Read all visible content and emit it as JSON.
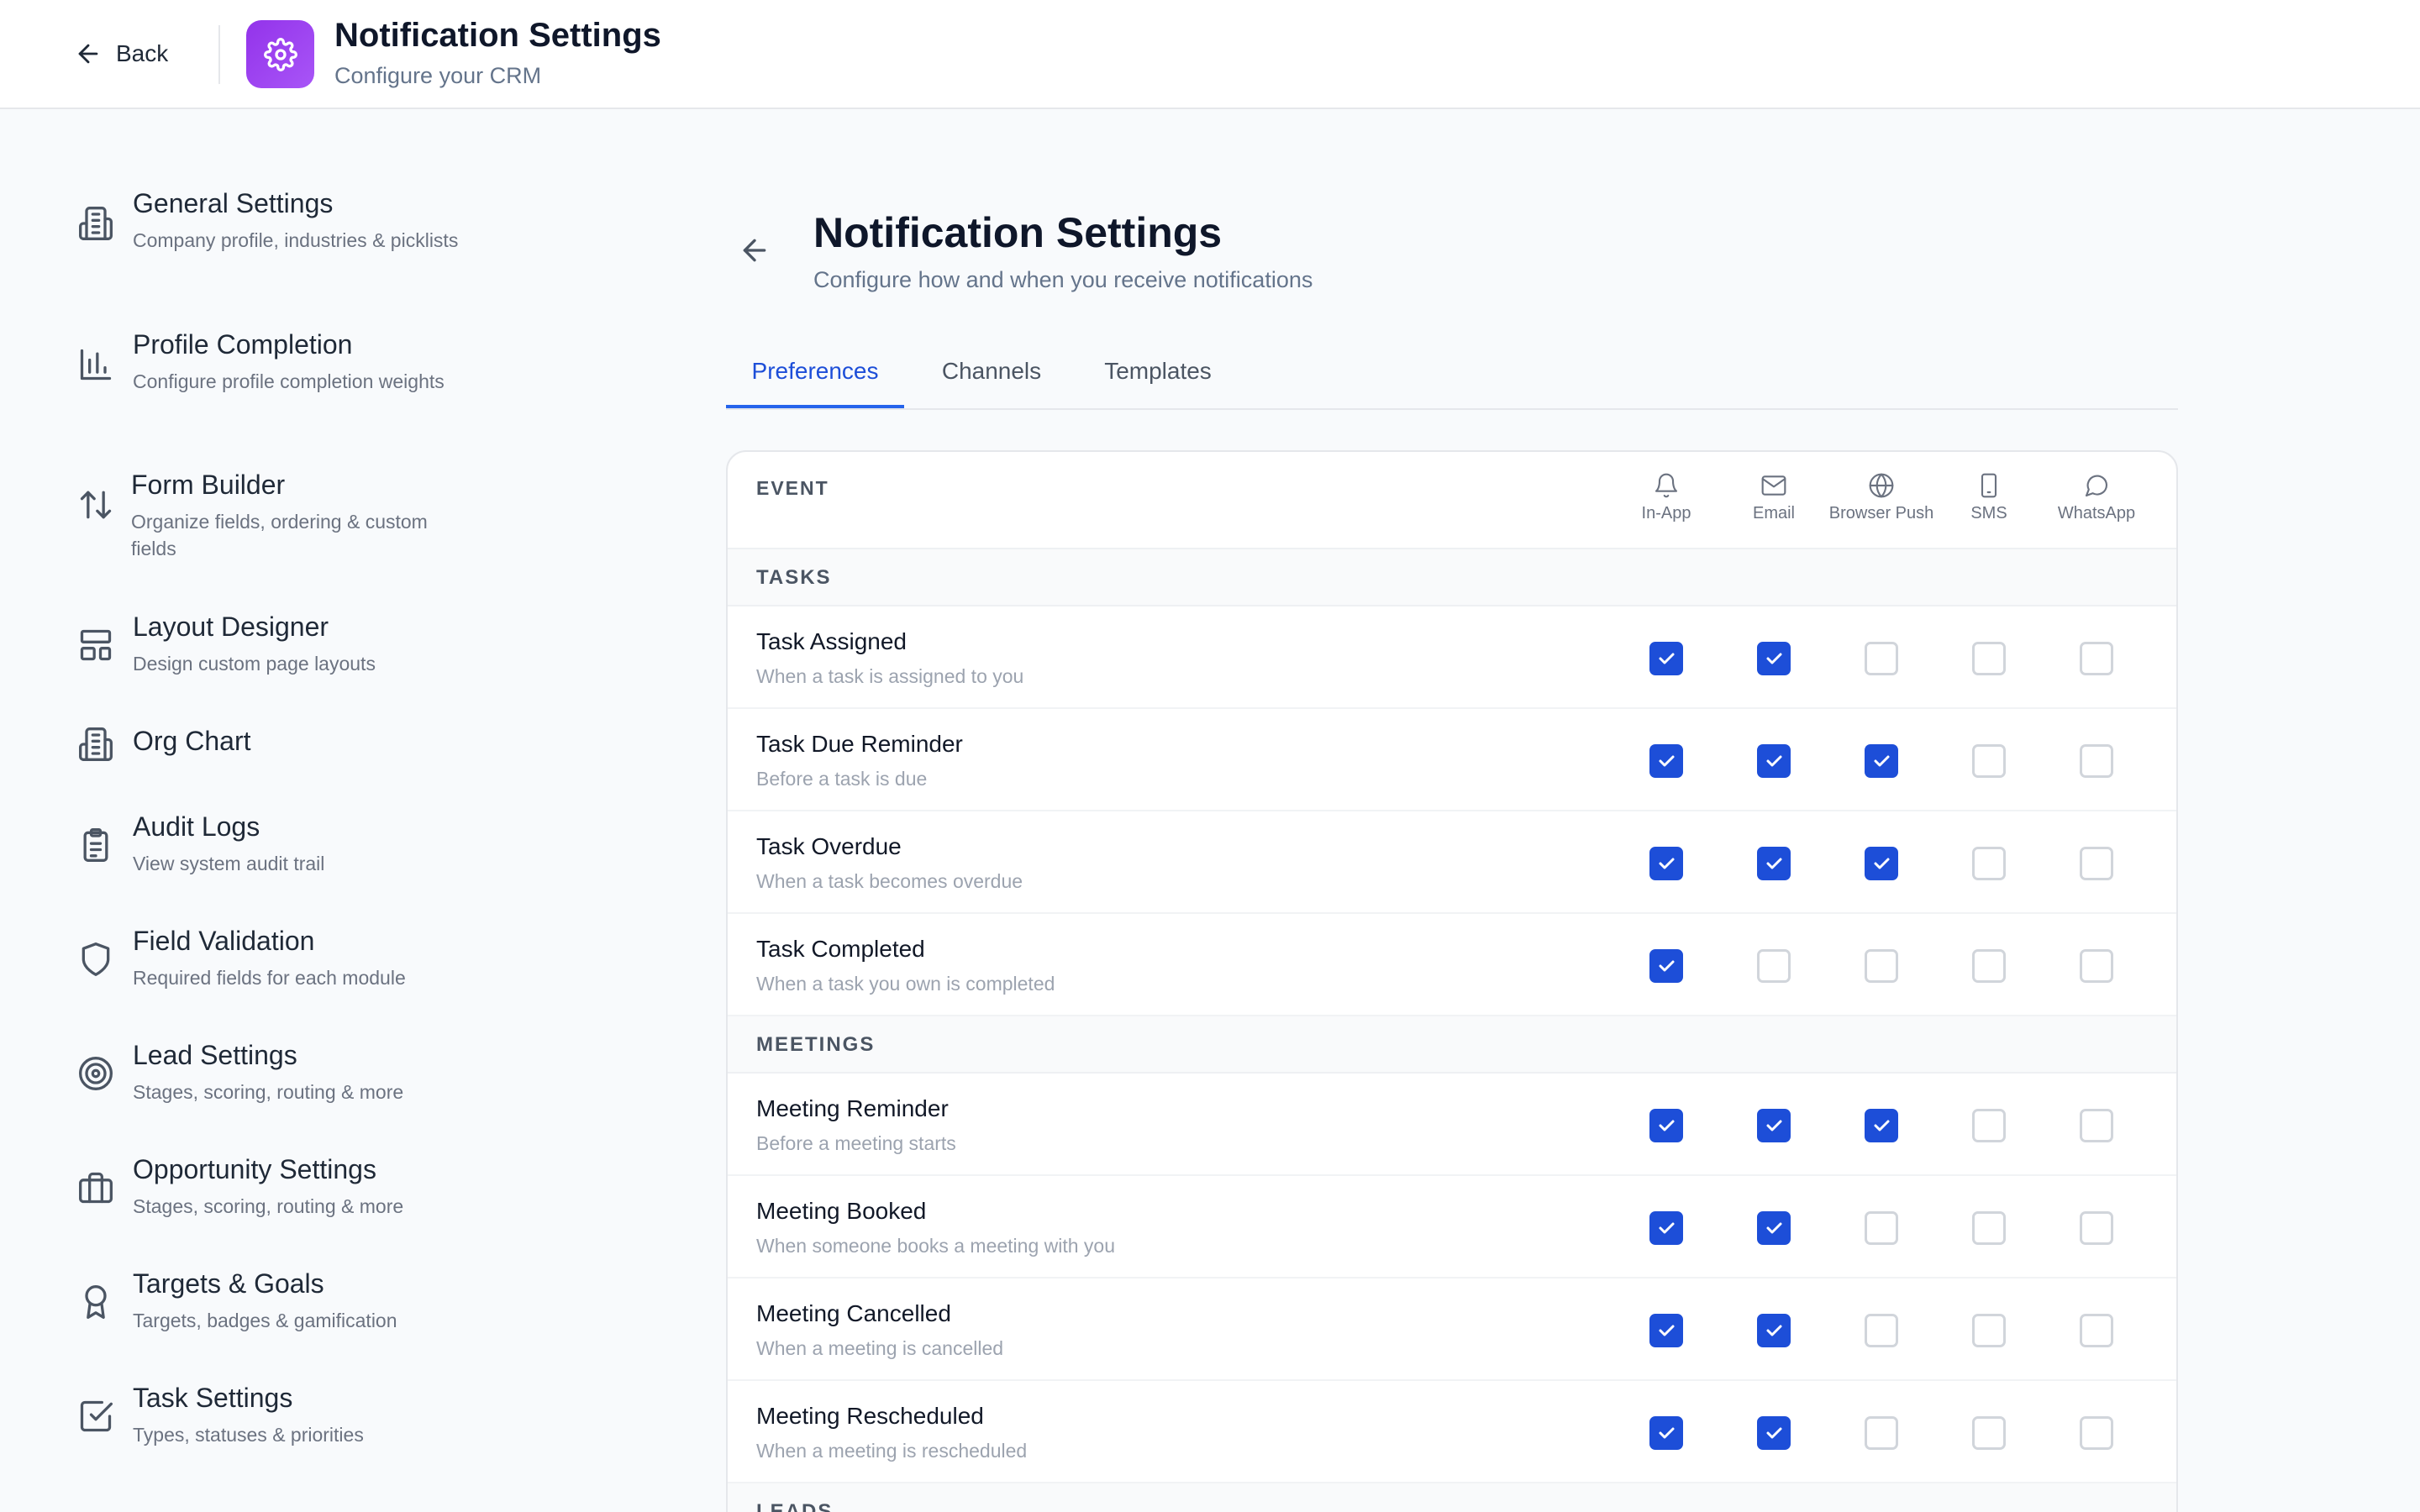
{
  "header": {
    "back_label": "Back",
    "title": "Notification Settings",
    "subtitle": "Configure your CRM"
  },
  "sidebar": {
    "items": [
      {
        "title": "General Settings",
        "desc": "Company profile, industries & picklists",
        "icon": "building-icon"
      },
      {
        "title": "Profile Completion",
        "desc": "Configure profile completion weights",
        "icon": "bar-chart-icon"
      },
      {
        "title": "Form Builder",
        "desc": "Organize fields, ordering & custom fields",
        "icon": "sort-arrows-icon"
      },
      {
        "title": "Layout Designer",
        "desc": "Design custom page layouts",
        "icon": "layout-icon"
      },
      {
        "title": "Org Chart",
        "desc": "",
        "icon": "building-icon"
      },
      {
        "title": "Audit Logs",
        "desc": "View system audit trail",
        "icon": "clipboard-icon"
      },
      {
        "title": "Field Validation",
        "desc": "Required fields for each module",
        "icon": "shield-icon"
      },
      {
        "title": "Lead Settings",
        "desc": "Stages, scoring, routing & more",
        "icon": "target-icon"
      },
      {
        "title": "Opportunity Settings",
        "desc": "Stages, scoring, routing & more",
        "icon": "briefcase-icon"
      },
      {
        "title": "Targets & Goals",
        "desc": "Targets, badges & gamification",
        "icon": "award-icon"
      },
      {
        "title": "Task Settings",
        "desc": "Types, statuses & priorities",
        "icon": "checkbox-icon"
      }
    ]
  },
  "main": {
    "title": "Notification Settings",
    "subtitle": "Configure how and when you receive notifications",
    "tabs": [
      {
        "label": "Preferences",
        "active": true
      },
      {
        "label": "Channels",
        "active": false
      },
      {
        "label": "Templates",
        "active": false
      }
    ]
  },
  "table": {
    "event_header": "EVENT",
    "channels": [
      {
        "label": "In-App",
        "icon": "bell-icon"
      },
      {
        "label": "Email",
        "icon": "mail-icon"
      },
      {
        "label": "Browser Push",
        "icon": "globe-icon"
      },
      {
        "label": "SMS",
        "icon": "phone-icon"
      },
      {
        "label": "WhatsApp",
        "icon": "chat-bubble-icon"
      }
    ],
    "sections": [
      {
        "name": "TASKS",
        "rows": [
          {
            "title": "Task Assigned",
            "desc": "When a task is assigned to you",
            "checks": [
              true,
              true,
              false,
              false,
              false
            ]
          },
          {
            "title": "Task Due Reminder",
            "desc": "Before a task is due",
            "checks": [
              true,
              true,
              true,
              false,
              false
            ]
          },
          {
            "title": "Task Overdue",
            "desc": "When a task becomes overdue",
            "checks": [
              true,
              true,
              true,
              false,
              false
            ]
          },
          {
            "title": "Task Completed",
            "desc": "When a task you own is completed",
            "checks": [
              true,
              false,
              false,
              false,
              false
            ]
          }
        ]
      },
      {
        "name": "MEETINGS",
        "rows": [
          {
            "title": "Meeting Reminder",
            "desc": "Before a meeting starts",
            "checks": [
              true,
              true,
              true,
              false,
              false
            ]
          },
          {
            "title": "Meeting Booked",
            "desc": "When someone books a meeting with you",
            "checks": [
              true,
              true,
              false,
              false,
              false
            ]
          },
          {
            "title": "Meeting Cancelled",
            "desc": "When a meeting is cancelled",
            "checks": [
              true,
              true,
              false,
              false,
              false
            ]
          },
          {
            "title": "Meeting Rescheduled",
            "desc": "When a meeting is rescheduled",
            "checks": [
              true,
              true,
              false,
              false,
              false
            ]
          }
        ]
      },
      {
        "name": "LEADS",
        "rows": []
      }
    ]
  },
  "colors": {
    "accent": "#1d4ed8",
    "app_icon": "#a855f7",
    "text_primary": "#0f172a",
    "text_muted": "#64748b"
  }
}
